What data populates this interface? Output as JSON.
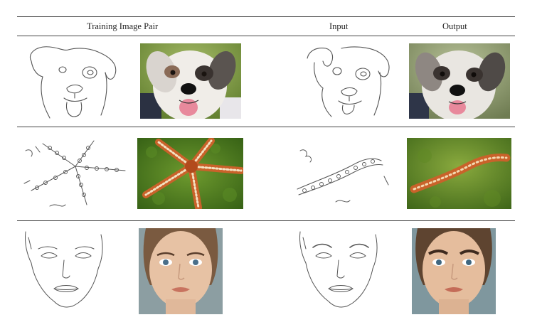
{
  "table": {
    "headers": {
      "training_pair": "Training Image Pair",
      "input": "Input",
      "output": "Output"
    },
    "rows": [
      {
        "subject": "dog"
      },
      {
        "subject": "starfish"
      },
      {
        "subject": "woman-face"
      }
    ]
  },
  "colors": {
    "rule": "#444444",
    "sketch_line": "#555555",
    "dog_fur": "#f0ede8",
    "dog_patch": "#3a3330",
    "dog_bg": "#7b9a3c",
    "sea_green": "#4d7a1f",
    "starfish": "#c9622a",
    "skin": "#e7c2a4",
    "portrait_bg": "#8c9ea2"
  }
}
